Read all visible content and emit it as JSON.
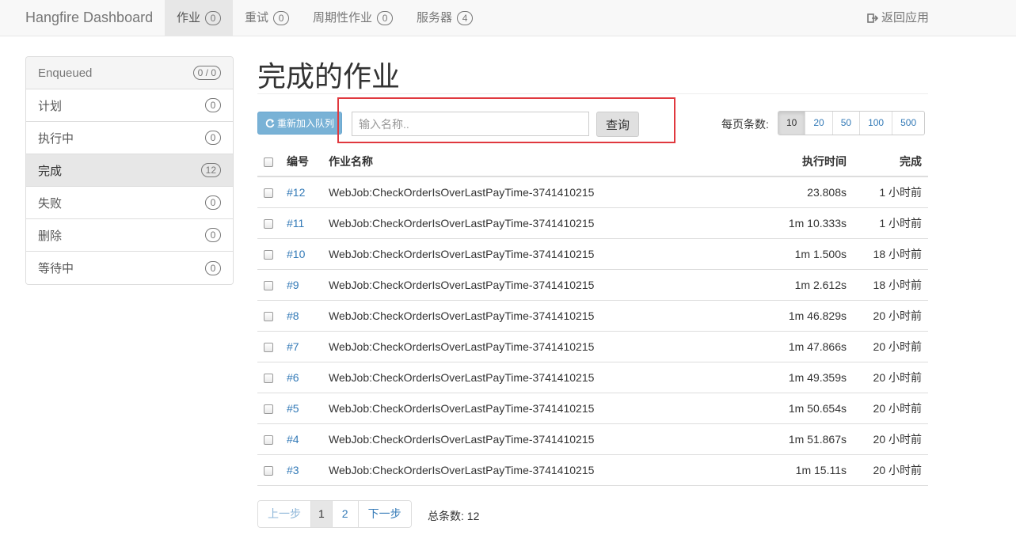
{
  "navbar": {
    "brand": "Hangfire Dashboard",
    "items": [
      {
        "label": "作业",
        "count": "0"
      },
      {
        "label": "重试",
        "count": "0"
      },
      {
        "label": "周期性作业",
        "count": "0"
      },
      {
        "label": "服务器",
        "count": "4"
      }
    ],
    "back_label": "返回应用"
  },
  "sidebar": {
    "items": [
      {
        "label": "Enqueued",
        "count": "0 / 0"
      },
      {
        "label": "计划",
        "count": "0"
      },
      {
        "label": "执行中",
        "count": "0"
      },
      {
        "label": "完成",
        "count": "12"
      },
      {
        "label": "失败",
        "count": "0"
      },
      {
        "label": "删除",
        "count": "0"
      },
      {
        "label": "等待中",
        "count": "0"
      }
    ]
  },
  "main": {
    "title": "完成的作业",
    "requeue_label": "重新加入队列",
    "search": {
      "placeholder": "输入名称..",
      "value": ""
    },
    "search_button": "查询",
    "per_page_label": "每页条数:",
    "per_page_options": [
      "10",
      "20",
      "50",
      "100",
      "500"
    ],
    "table": {
      "headers": {
        "id": "编号",
        "name": "作业名称",
        "duration": "执行时间",
        "finished": "完成"
      },
      "rows": [
        {
          "id": "#12",
          "name": "WebJob:CheckOrderIsOverLastPayTime-3741410215",
          "duration": "23.808s",
          "finished": "1 小时前"
        },
        {
          "id": "#11",
          "name": "WebJob:CheckOrderIsOverLastPayTime-3741410215",
          "duration": "1m 10.333s",
          "finished": "1 小时前"
        },
        {
          "id": "#10",
          "name": "WebJob:CheckOrderIsOverLastPayTime-3741410215",
          "duration": "1m 1.500s",
          "finished": "18 小时前"
        },
        {
          "id": "#9",
          "name": "WebJob:CheckOrderIsOverLastPayTime-3741410215",
          "duration": "1m 2.612s",
          "finished": "18 小时前"
        },
        {
          "id": "#8",
          "name": "WebJob:CheckOrderIsOverLastPayTime-3741410215",
          "duration": "1m 46.829s",
          "finished": "20 小时前"
        },
        {
          "id": "#7",
          "name": "WebJob:CheckOrderIsOverLastPayTime-3741410215",
          "duration": "1m 47.866s",
          "finished": "20 小时前"
        },
        {
          "id": "#6",
          "name": "WebJob:CheckOrderIsOverLastPayTime-3741410215",
          "duration": "1m 49.359s",
          "finished": "20 小时前"
        },
        {
          "id": "#5",
          "name": "WebJob:CheckOrderIsOverLastPayTime-3741410215",
          "duration": "1m 50.654s",
          "finished": "20 小时前"
        },
        {
          "id": "#4",
          "name": "WebJob:CheckOrderIsOverLastPayTime-3741410215",
          "duration": "1m 51.867s",
          "finished": "20 小时前"
        },
        {
          "id": "#3",
          "name": "WebJob:CheckOrderIsOverLastPayTime-3741410215",
          "duration": "1m 15.11s",
          "finished": "20 小时前"
        }
      ]
    },
    "pager": {
      "prev": "上一步",
      "pages": [
        "1",
        "2"
      ],
      "next": "下一步"
    },
    "total": "总条数: 12"
  },
  "colors": {
    "link": "#337ab7",
    "highlight": "#e0383e",
    "requeue": "#79b2d6"
  }
}
